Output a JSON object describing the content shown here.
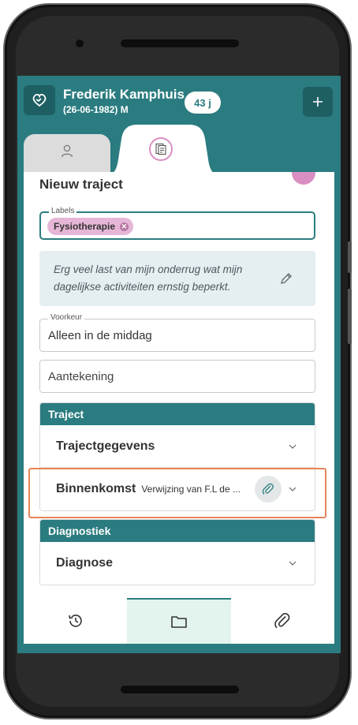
{
  "header": {
    "name": "Frederik Kamphuis",
    "dob_gender": "(26-06-1982) M",
    "age_badge": "43 j"
  },
  "tabs": [
    {
      "icon": "person-icon",
      "active": false
    },
    {
      "icon": "dossier-icon",
      "active": true
    }
  ],
  "section": {
    "title": "Nieuw traject"
  },
  "labels_field": {
    "legend": "Labels",
    "chips": [
      "Fysiotherapie"
    ]
  },
  "complaint_note": "Erg veel last van mijn onderrug wat mijn dagelijkse activiteiten ernstig beperkt.",
  "preference_field": {
    "legend": "Voorkeur",
    "value": "Alleen in de middag"
  },
  "note_field": {
    "placeholder": "Aantekening"
  },
  "panels": {
    "traject": {
      "header": "Traject",
      "rows": [
        {
          "title": "Trajectgegevens",
          "subtitle": ""
        },
        {
          "title": "Binnenkomst",
          "subtitle": "Verwijzing van F.L de ..."
        }
      ]
    },
    "diagnostiek": {
      "header": "Diagnostiek",
      "rows": [
        {
          "title": "Diagnose",
          "subtitle": ""
        }
      ]
    }
  },
  "bottom_nav": [
    {
      "icon": "history-icon",
      "active": false
    },
    {
      "icon": "folder-icon",
      "active": true
    },
    {
      "icon": "paperclip-icon",
      "active": false
    }
  ],
  "colors": {
    "primary": "#2b7c80",
    "primary_dark": "#1d5f63",
    "accent_pink": "#d98ec1",
    "chip_bg": "#e6b6d7",
    "note_bg": "#e5eef1",
    "highlight": "#e8845a",
    "nav_active_bg": "#e3f4ef"
  }
}
